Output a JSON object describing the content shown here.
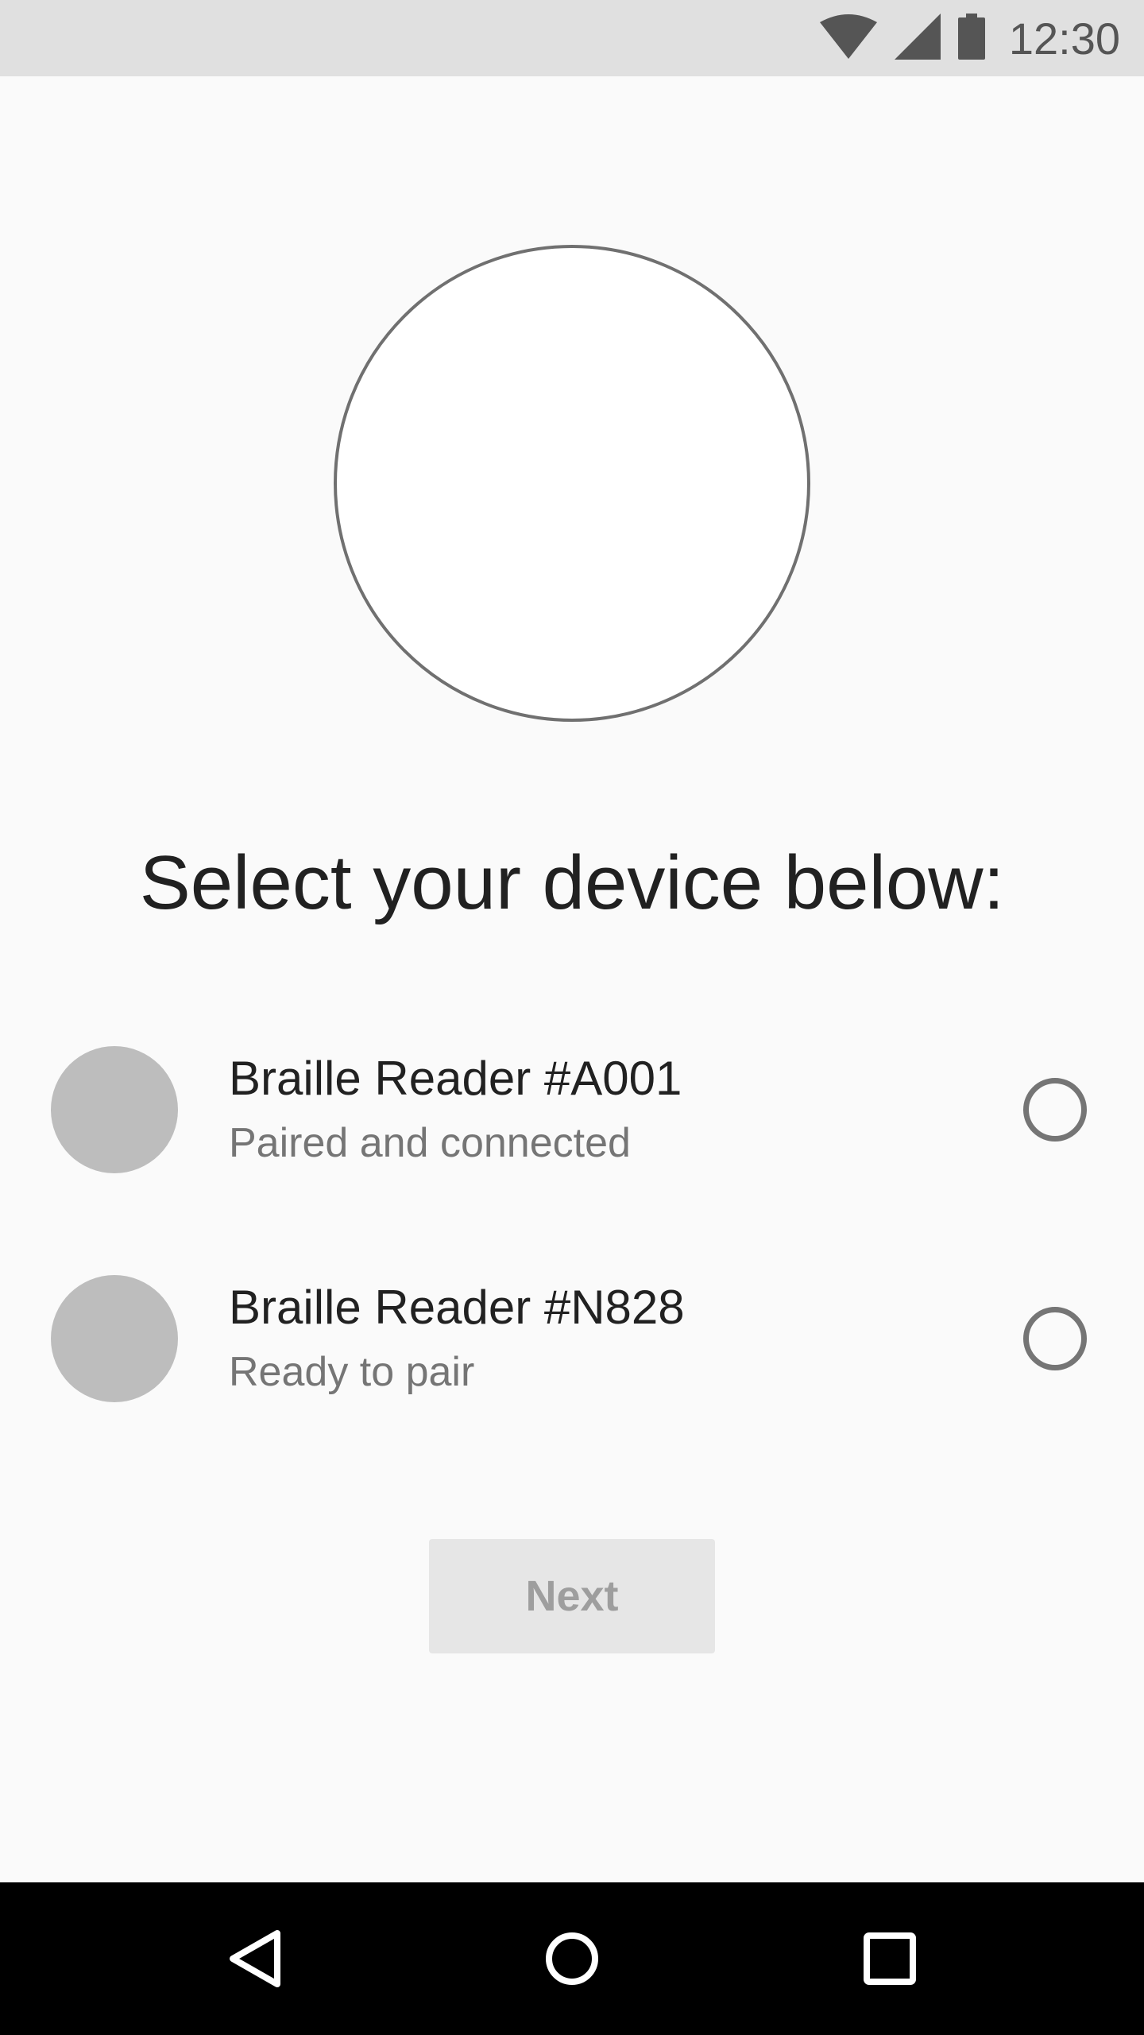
{
  "status_bar": {
    "time": "12:30",
    "icons": [
      "wifi-icon",
      "cell-signal-icon",
      "battery-icon"
    ]
  },
  "main": {
    "heading": "Select your device below:",
    "devices": [
      {
        "name": "Braille Reader #A001",
        "status": "Paired and connected",
        "selected": false
      },
      {
        "name": "Braille Reader #N828",
        "status": "Ready to pair",
        "selected": false
      }
    ],
    "next_label": "Next"
  },
  "nav_bar": {
    "icons": [
      "back-icon",
      "home-icon",
      "recents-icon"
    ]
  },
  "colors": {
    "status_bar_bg": "#e0e0e0",
    "screen_bg": "#fafafa",
    "avatar": "#bdbdbd",
    "button_bg": "#e6e6e6",
    "button_text": "#9e9e9e",
    "nav_bar_bg": "#000000"
  }
}
